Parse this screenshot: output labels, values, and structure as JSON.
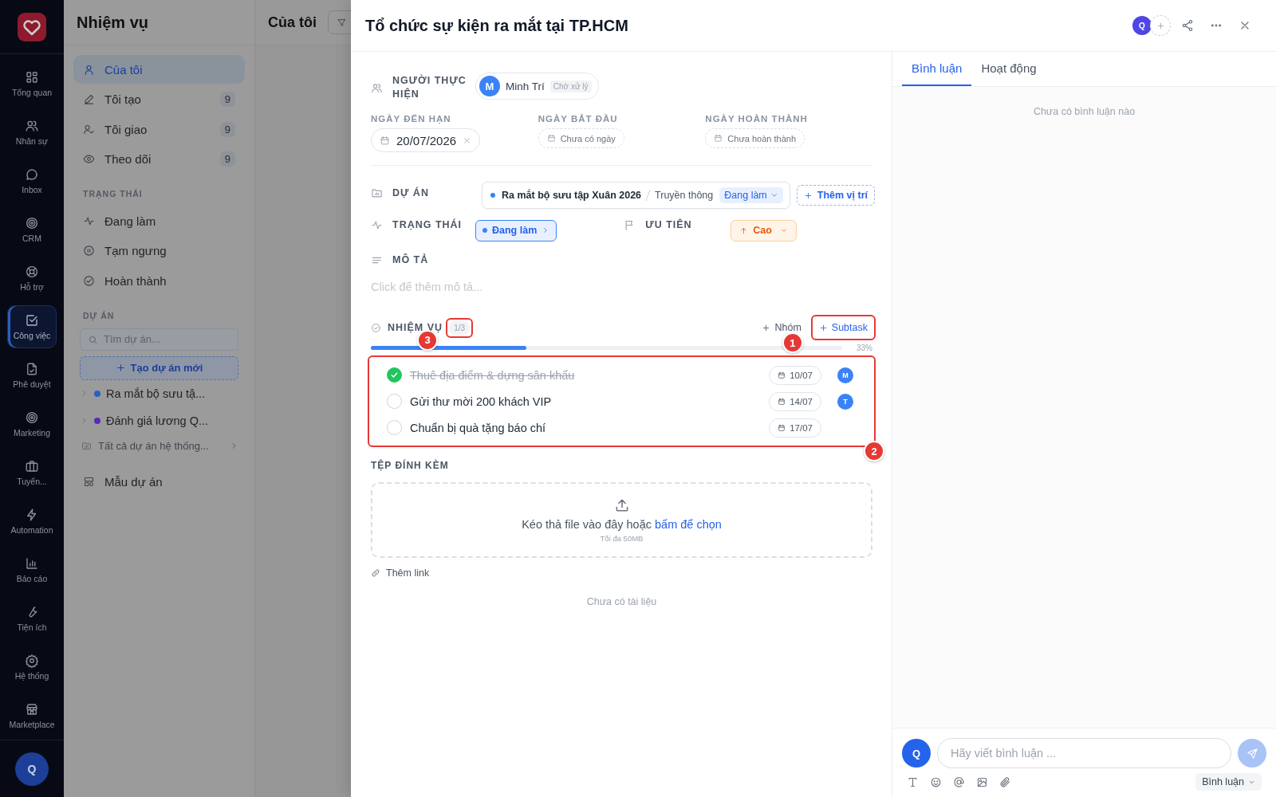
{
  "rail": {
    "items": [
      {
        "label": "Tổng quan",
        "selected": false
      },
      {
        "label": "Nhân sự",
        "selected": false
      },
      {
        "label": "Inbox",
        "selected": false
      },
      {
        "label": "CRM",
        "selected": false
      },
      {
        "label": "Hỗ trợ",
        "selected": false
      },
      {
        "label": "Công việc",
        "selected": true
      },
      {
        "label": "Phê duyệt",
        "selected": false
      },
      {
        "label": "Marketing",
        "selected": false
      },
      {
        "label": "Tuyển...",
        "selected": false
      },
      {
        "label": "Automation",
        "selected": false
      },
      {
        "label": "Báo cáo",
        "selected": false
      },
      {
        "label": "Tiện ích",
        "selected": false
      },
      {
        "label": "Hệ thống",
        "selected": false
      },
      {
        "label": "Marketplace",
        "selected": false
      }
    ],
    "avatar": "Q"
  },
  "sidebar": {
    "title": "Nhiệm vụ",
    "items": [
      {
        "label": "Của tôi",
        "selected": true
      },
      {
        "label": "Tôi tạo",
        "count": "9",
        "selected": false
      },
      {
        "label": "Tôi giao",
        "count": "9",
        "selected": false
      },
      {
        "label": "Theo dõi",
        "count": "9",
        "selected": false
      }
    ],
    "status_heading": "TRẠNG THÁI",
    "status_items": [
      {
        "label": "Đang làm"
      },
      {
        "label": "Tạm ngưng"
      },
      {
        "label": "Hoàn thành"
      }
    ],
    "project_heading": "DỰ ÁN",
    "project_search": {
      "placeholder": "Tìm dự án..."
    },
    "new_project": "Tạo dự án mới",
    "projects": [
      {
        "name": "Ra mắt bộ sưu tậ...",
        "color": "#2c5fc4"
      },
      {
        "name": "Đánh giá lương Q...",
        "color": "#5b2bb0"
      }
    ],
    "all_projects": "Tất cả dự án hệ thống...",
    "templates": "Mẫu dự án"
  },
  "main": {
    "title": "Của tôi"
  },
  "task": {
    "title": "Tổ chức sự kiện ra mắt tại TP.HCM",
    "watcher": "Q",
    "assignee_label": "NGƯỜI THỰC HIỆN",
    "assignee": {
      "initial": "M",
      "name": "Minh Trí",
      "status": "Chờ xử lý"
    },
    "dates": [
      {
        "label": "NGÀY ĐẾN HẠN",
        "value": "20/07/2026"
      },
      {
        "label": "NGÀY BẮT ĐẦU",
        "placeholder": "Chưa có ngày"
      },
      {
        "label": "NGÀY HOÀN THÀNH",
        "placeholder": "Chưa hoàn thành"
      }
    ],
    "project_label": "DỰ ÁN",
    "project": {
      "name": "Ra mắt bộ sưu tập Xuân 2026",
      "section": "Truyền thông",
      "status": "Đang làm"
    },
    "add_location": "Thêm vị trí",
    "status_label": "TRẠNG THÁI",
    "status": "Đang làm",
    "priority_label": "ƯU TIÊN",
    "priority": "Cao",
    "description_label": "MÔ TẢ",
    "description": {
      "placeholder": "Click để thêm mô tả..."
    },
    "subtasks": {
      "label": "NHIỆM VỤ",
      "count": "1/3",
      "add_group": "Nhóm",
      "add_subtask": "Subtask",
      "level": 0.33,
      "percent": "33%",
      "items": [
        {
          "title": "Thuê địa điểm & dựng sân khấu",
          "checked": true,
          "due": "10/07",
          "assignee": "M"
        },
        {
          "title": "Gửi thư mời 200 khách VIP",
          "checked": false,
          "due": "14/07",
          "assignee": "T"
        },
        {
          "title": "Chuẩn bị quà tặng báo chí",
          "checked": false,
          "due": "17/07"
        }
      ]
    },
    "attachments": {
      "label": "TỆP ĐÍNH KÈM",
      "drop_text": "Kéo thả file vào đây hoặc",
      "drop_link": "bấm để chọn",
      "limit": "Tối đa 50MB",
      "add_link": "Thêm link",
      "empty": "Chưa có tài liệu"
    }
  },
  "comments": {
    "tabs": [
      {
        "label": "Bình luận",
        "selected": true
      },
      {
        "label": "Hoạt động",
        "selected": false
      }
    ],
    "empty": "Chưa có bình luận nào",
    "avatar": "Q",
    "input": {
      "placeholder": "Hãy viết bình luận ..."
    },
    "mode": "Bình luận"
  },
  "annotations": [
    {
      "label": "1"
    },
    {
      "label": "2"
    },
    {
      "label": "3"
    }
  ]
}
